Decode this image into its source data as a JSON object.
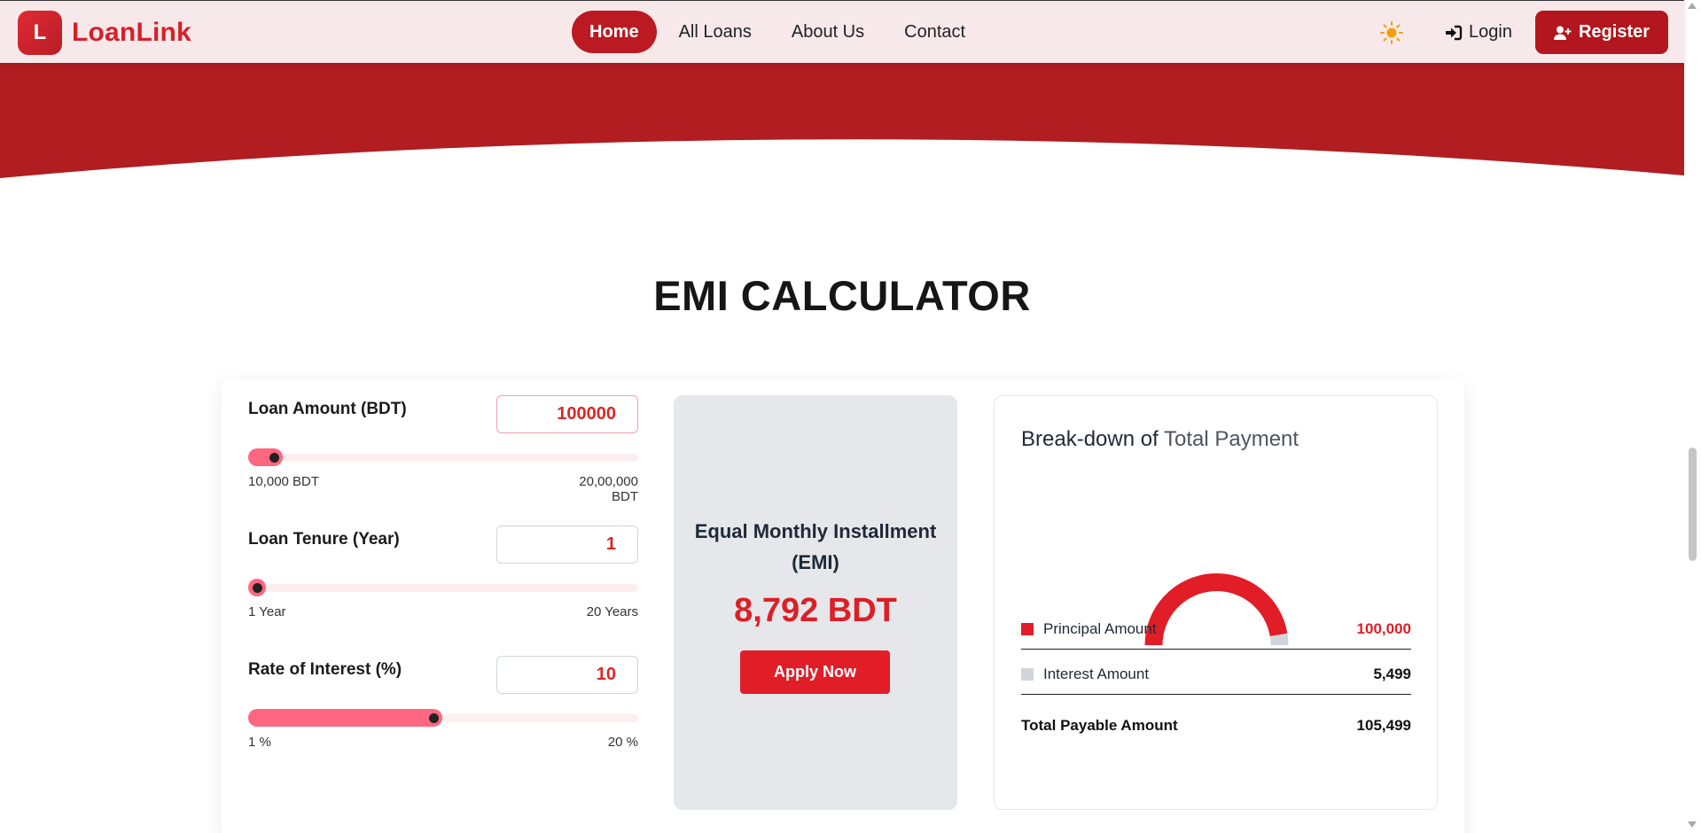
{
  "brand": {
    "logo_letter": "L",
    "name": "LoanLink"
  },
  "nav": {
    "items": [
      {
        "label": "Home",
        "active": true
      },
      {
        "label": "All Loans",
        "active": false
      },
      {
        "label": "About Us",
        "active": false
      },
      {
        "label": "Contact",
        "active": false
      }
    ],
    "login_label": "Login",
    "register_label": "Register"
  },
  "colors": {
    "primary": "#b3161e",
    "accent": "#e11d27",
    "slider": "#ff6680",
    "interest": "#d1d5db"
  },
  "calculator": {
    "title": "EMI CALCULATOR",
    "loan_amount": {
      "label": "Loan Amount (BDT)",
      "value": "100000",
      "min_label": "10,000 BDT",
      "max_label": "20,00,000 BDT",
      "slider_fraction": 0.045
    },
    "tenure": {
      "label": "Loan Tenure (Year)",
      "value": "1",
      "min_label": "1 Year",
      "max_label": "20 Years",
      "slider_fraction": 0.0
    },
    "interest": {
      "label": "Rate of Interest (%)",
      "value": "10",
      "min_label": "1 %",
      "max_label": "20 %",
      "slider_fraction": 0.474
    },
    "emi": {
      "title": "Equal Monthly Installment (EMI)",
      "value": "8,792 BDT",
      "apply_label": "Apply Now"
    },
    "breakdown": {
      "title_bold": "Break-down of",
      "title_light": "Total Payment",
      "principal": {
        "label": "Principal Amount",
        "value": "100,000"
      },
      "interest": {
        "label": "Interest Amount",
        "value": "5,499"
      },
      "total": {
        "label": "Total Payable Amount",
        "value": "105,499"
      }
    }
  },
  "chart_data": {
    "type": "pie",
    "categories": [
      "Principal Amount",
      "Interest Amount"
    ],
    "values": [
      100000,
      5499
    ],
    "colors": [
      "#e11d27",
      "#d1d5db"
    ]
  }
}
